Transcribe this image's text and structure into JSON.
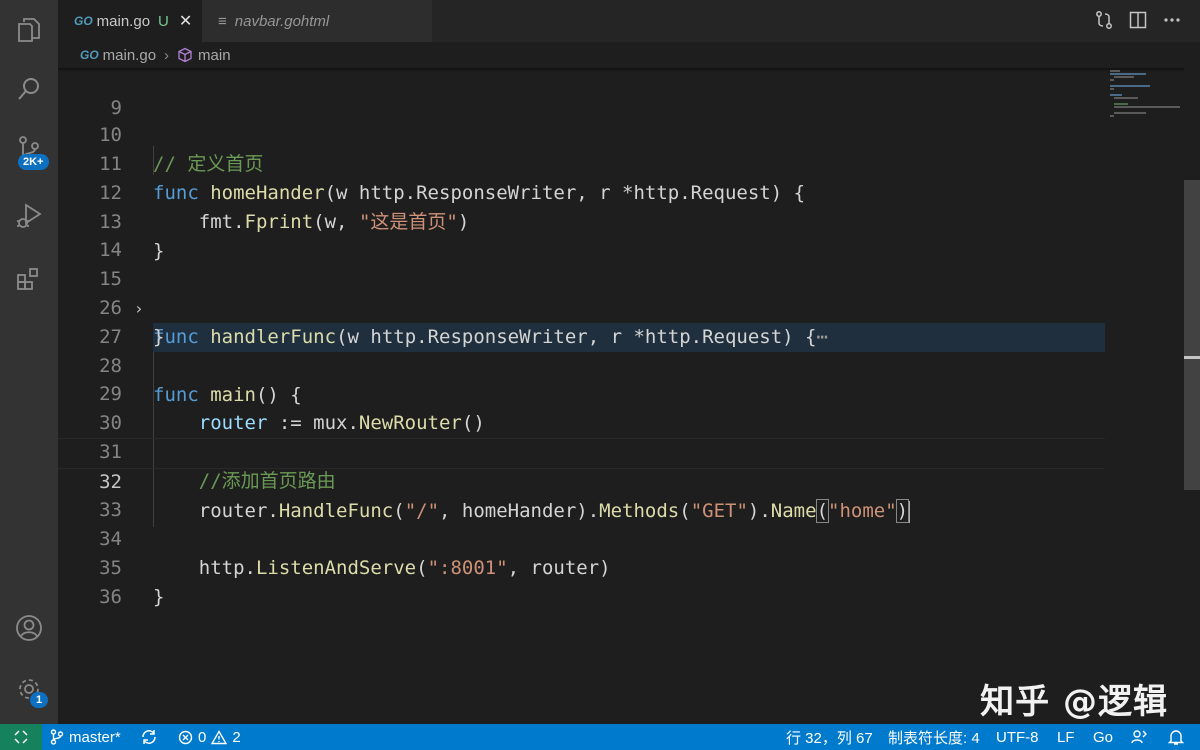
{
  "tabs": [
    {
      "lang_glyph": "GO",
      "label": "main.go",
      "status": "U",
      "close": "✕"
    },
    {
      "lang_glyph": "≡",
      "label": "navbar.gohtml"
    }
  ],
  "breadcrumb": {
    "file_glyph": "GO",
    "file": "main.go",
    "separator": "›",
    "symbol": "main"
  },
  "activity_bar": {
    "items": [
      "explorer-icon",
      "search-icon",
      "source-control-icon",
      "run-debug-icon",
      "extensions-icon"
    ],
    "source_control_badge": "2K+",
    "bottom": [
      "account-icon",
      "manage-gear-icon"
    ],
    "settings_badge": "1"
  },
  "editor": {
    "line_numbers": {
      "l9": "9",
      "l10": "10",
      "l11": "11",
      "l12": "12",
      "l14": "14",
      "l13": "13",
      "l15": "15",
      "l26": "26",
      "l27": "27",
      "l28": "28",
      "l29": "29",
      "l30": "30",
      "l31": "31",
      "l32": "32",
      "l33": "33",
      "l34": "34",
      "l35": "35",
      "l36": "36"
    },
    "tokens": {
      "l10_comment": "// 定义首页",
      "func": "func",
      "l11_name": "homeHander",
      "l11_rest": "(w http.ResponseWriter, r *http.Request) {",
      "l12_a": "fmt.",
      "l12_fn": "Fprint",
      "l12_b": "(w, ",
      "l12_str": "\"这是首页\"",
      "l12_c": ")",
      "close_brace": "}",
      "l15_name": "handlerFunc",
      "l15_rest": "(w http.ResponseWriter, r *http.Request) {",
      "l15_ellipsis": "⋯",
      "l28_name": "main",
      "l28_rest": "() {",
      "router": "router",
      "l29_op": " := mux.",
      "l29_fn": "NewRouter",
      "l29_end": "()",
      "l31_comment": "//添加首页路由",
      "l32_a": "router.",
      "l32_fn1": "HandleFunc",
      "l32_p1": "(",
      "l32_s1": "\"/\"",
      "l32_mid": ", homeHander).",
      "l32_fn2": "Methods",
      "l32_p2": "(",
      "l32_s2": "\"GET\"",
      "l32_p3": ").",
      "l32_fn3": "Name",
      "l32_p4": "(",
      "l32_s3": "\"home\"",
      "l32_p5": ")",
      "l34_a": "http.",
      "l34_fn": "ListenAndServe",
      "l34_p1": "(",
      "l34_s": "\":8001\"",
      "l34_end": ", router)"
    },
    "fold_glyph": "›"
  },
  "status_bar": {
    "branch": "master*",
    "errors": "0",
    "warnings": "2",
    "cursor_position": "行 32，列 67",
    "indentation": "制表符长度: 4",
    "encoding": "UTF-8",
    "eol": "LF",
    "language": "Go"
  },
  "watermark": "知乎 @逻辑",
  "colors": {
    "accent": "#007acc",
    "remote": "#16825d",
    "keyword": "#569cd6",
    "function": "#dcdcaa",
    "string": "#ce9178",
    "comment": "#6a9955",
    "variable": "#9cdcfe"
  }
}
